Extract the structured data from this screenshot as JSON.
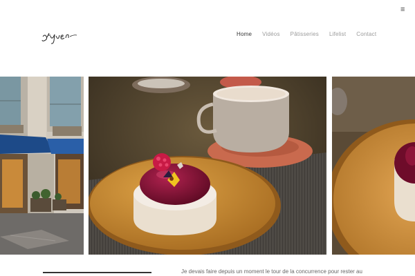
{
  "header": {
    "logo_text": "styven",
    "menu_icon": "hamburger-menu-icon"
  },
  "nav": {
    "items": [
      {
        "label": "Home",
        "active": true
      },
      {
        "label": "Vidéos",
        "active": false
      },
      {
        "label": "Pâtisseries",
        "active": false
      },
      {
        "label": "Lifelist",
        "active": false
      },
      {
        "label": "Contact",
        "active": false
      }
    ]
  },
  "intro": {
    "text": "Je devais faire depuis un moment le tour de la concurrence pour rester au"
  },
  "colors": {
    "nav_active": "#333333",
    "nav_inactive": "#9a9a9a",
    "glaze": "#7a1030",
    "plate": "#c8892e"
  }
}
